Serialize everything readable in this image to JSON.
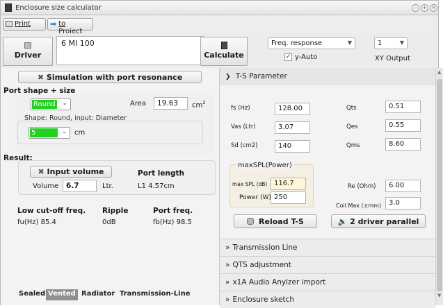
{
  "window": {
    "title": "Enclosure size calculator"
  },
  "toolbar": {
    "print_label": "Print",
    "project_label": "to Project"
  },
  "header": {
    "driver_button": "Driver",
    "driver_name": "6 MI 100",
    "calculate_button": "Calculate",
    "plot_select": "Freq. response",
    "yauto_label": "y-Auto",
    "output_select": "1",
    "output_label": "XY Output"
  },
  "left": {
    "simulation_button": "Simulation with port resonance",
    "port_shape_title": "Port shape + size",
    "shape_select": "Round",
    "area_label": "Area",
    "area_value": "19.63",
    "area_unit": "cm",
    "area_unit_sup": "2",
    "shape_group_label": "Shape: Round, input: Diameter",
    "diameter_select": "5",
    "diameter_unit": "cm",
    "result_title": "Result:",
    "input_volume_button": "Input volume",
    "volume_label": "Volume",
    "volume_value": "6.7",
    "volume_unit": "Ltr.",
    "port_length_title": "Port length",
    "port_length_value": "L1  4.57cm",
    "low_cutoff_title": "Low cut-off freq.",
    "low_cutoff_value": "fu(Hz) 85.4",
    "ripple_title": "Ripple",
    "ripple_value": "0dB",
    "port_freq_title": "Port freq.",
    "port_freq_value": "fb(Hz) 98.5"
  },
  "tabs": [
    "Sealed",
    "Vented",
    "Radiator",
    "Transmission-Line"
  ],
  "active_tab": "Vented",
  "right": {
    "ts_header": "T-S Parameter",
    "fs_label": "fs (Hz)",
    "fs_value": "128.00",
    "vas_label": "Vas (Ltr)",
    "vas_value": "3.07",
    "sd_label": "Sd (cm2)",
    "sd_value": "140",
    "qts_label": "Qts",
    "qts_value": "0.51",
    "qes_label": "Qes",
    "qes_value": "0.55",
    "qms_label": "Qms",
    "qms_value": "8.60",
    "maxspl_title": "maxSPL(Power)",
    "maxspl_label": "max SPL (dB)",
    "maxspl_value": "116.7",
    "power_label": "Power (W)",
    "power_value": "250",
    "re_label": "Re (Ohm)",
    "re_value": "6.00",
    "coilmax_label": "Coil Max (±mm)",
    "coilmax_value": "3.0",
    "reload_button": "Reload T-S",
    "parallel_button": "2 driver parallel",
    "sections": [
      "Transmission Line",
      "QTS adjustment",
      "x1A Audio Anylzer import",
      "Enclosure sketch"
    ]
  },
  "colors": {
    "green_highlight": "#22d11f",
    "panel_bg": "#f3f3f3"
  }
}
